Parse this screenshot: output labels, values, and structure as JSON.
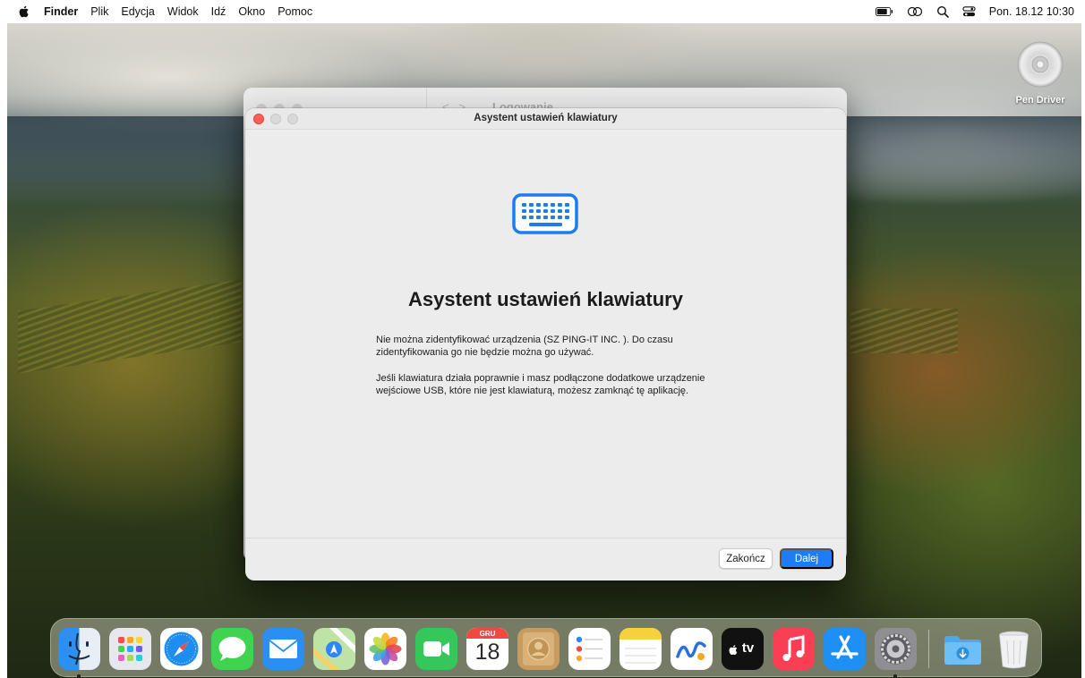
{
  "menubar": {
    "app_name": "Finder",
    "items": [
      "Plik",
      "Edycja",
      "Widok",
      "Idź",
      "Okno",
      "Pomoc"
    ],
    "clock": "Pon. 18.12  10:30"
  },
  "desktop": {
    "disk_label": "Pen Driver"
  },
  "background_window": {
    "title": "Logowanie"
  },
  "dialog": {
    "window_title": "Asystent ustawień klawiatury",
    "heading": "Asystent ustawień klawiatury",
    "paragraph1": "Nie można zidentyfikować urządzenia (SZ PING-IT INC. ). Do czasu zidentyfikowania go nie będzie można go używać.",
    "paragraph2": "Jeśli klawiatura działa poprawnie i masz podłączone dodatkowe urządzenie wejściowe USB, które nie jest klawiaturą, możesz zamknąć tę aplikację.",
    "quit_label": "Zakończ",
    "next_label": "Dalej",
    "accent_color": "#1e7cf5"
  },
  "dock": {
    "calendar_month": "GRU",
    "calendar_day": "18",
    "tv_label": "tv",
    "apps": [
      "finder",
      "launchpad",
      "safari",
      "messages",
      "mail",
      "maps",
      "photos",
      "facetime",
      "calendar",
      "contacts",
      "reminders",
      "notes",
      "freeform",
      "tv",
      "music",
      "app-store",
      "system-settings",
      "downloads",
      "trash"
    ]
  }
}
